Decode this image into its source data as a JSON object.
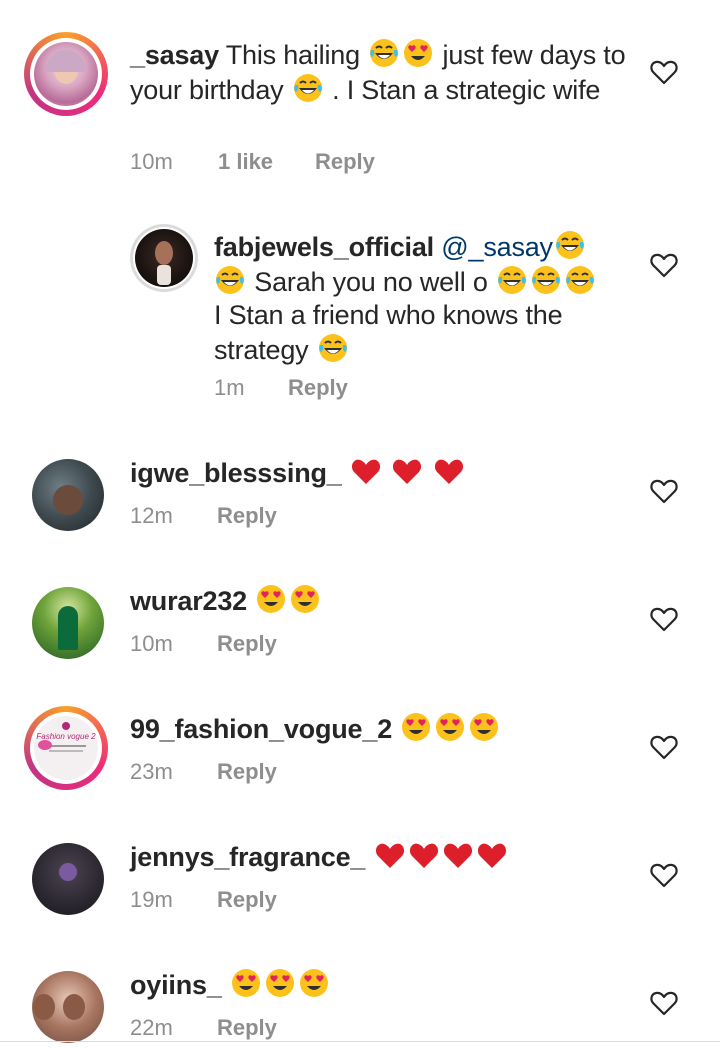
{
  "comments": [
    {
      "username": "_sasay",
      "text_parts": [
        "This hailing ",
        "[laugh]",
        "[hearteyes]",
        " just few days to your birthday ",
        "[laugh]",
        " . I Stan a strategic wife"
      ],
      "time": "10m",
      "likes": "1 like",
      "reply": "Reply"
    },
    {
      "username": "fabjewels_official",
      "mention": "@_sasay",
      "text_line2": " Sarah you no well o ",
      "text_line3": "I Stan a friend who knows the",
      "text_line4": "strategy ",
      "time": "1m",
      "reply": "Reply"
    },
    {
      "username": "igwe_blesssing_",
      "time": "12m",
      "reply": "Reply"
    },
    {
      "username": "wurar232",
      "time": "10m",
      "reply": "Reply"
    },
    {
      "username": "99_fashion_vogue_2",
      "time": "23m",
      "reply": "Reply",
      "avatar_text": "Fashion vogue 2"
    },
    {
      "username": "jennys_fragrance_",
      "time": "19m",
      "reply": "Reply"
    },
    {
      "username": "oyiins_",
      "time": "22m",
      "reply": "Reply"
    }
  ],
  "icons": {
    "like": "heart-outline-icon",
    "laugh": "face-with-tears-of-joy-emoji",
    "hearteyes": "smiling-face-with-heart-eyes-emoji",
    "heart": "red-heart-emoji"
  },
  "colors": {
    "text": "#262626",
    "meta": "#8e8e8e",
    "mention": "#00376b",
    "ring_start": "#f9a02a",
    "ring_end": "#d6249f"
  }
}
